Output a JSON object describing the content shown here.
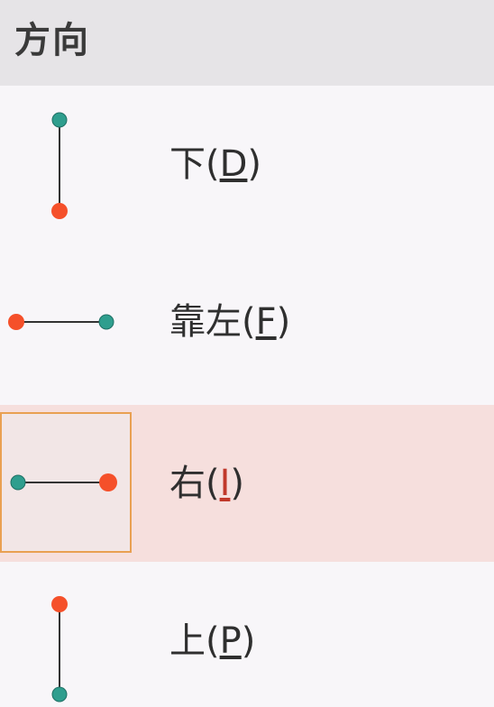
{
  "menu": {
    "title": "方向",
    "items": [
      {
        "name": "down",
        "label": "下",
        "accel": "D",
        "selected": false
      },
      {
        "name": "left",
        "label": "靠左",
        "accel": "F",
        "selected": false
      },
      {
        "name": "right",
        "label": "右",
        "accel": "I",
        "selected": true
      },
      {
        "name": "up",
        "label": "上",
        "accel": "P",
        "selected": false
      }
    ]
  },
  "colors": {
    "start_dot": "#2f9e8e",
    "end_dot": "#f5502a",
    "line": "#333333",
    "selected_bg": "#f6dfdd",
    "selected_border": "#e9a052"
  },
  "icons": [
    "direction-down-icon",
    "direction-left-icon",
    "direction-right-icon",
    "direction-up-icon"
  ]
}
